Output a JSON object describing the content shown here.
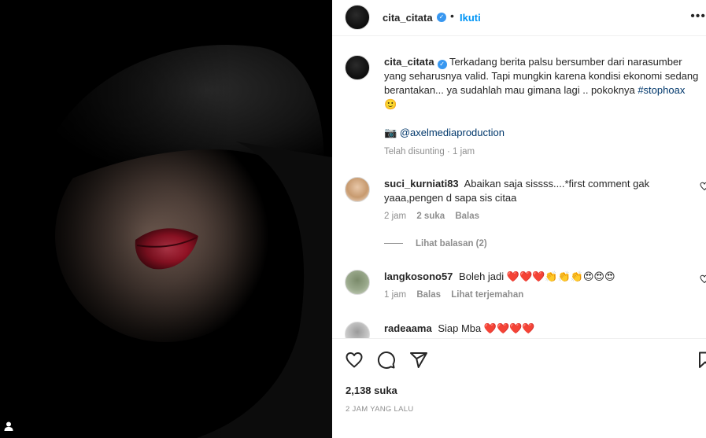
{
  "post": {
    "author": "cita_citata",
    "follow_label": "Ikuti",
    "separator": "•",
    "more_label": "•••"
  },
  "caption": {
    "author": "cita_citata",
    "text": "Terkadang berita palsu bersumber dari narasumber yang seharusnya valid. Tapi mungkin karena kondisi ekonomi sedang berantakan... ya sudahlah mau gimana lagi .. pokoknya ",
    "hashtag": "#stophoax",
    "emoji": "🙂",
    "credit_emoji": "📷",
    "credit_mention": "@axelmediaproduction",
    "edited": "Telah disunting",
    "edited_sep": "·",
    "time": "1 jam"
  },
  "comments": [
    {
      "user": "suci_kurniati83",
      "text": "Abaikan saja sissss....*first comment gak yaaa,pengen d sapa sis citaa",
      "time": "2 jam",
      "likes": "2 suka",
      "reply": "Balas",
      "view_replies": "Lihat balasan (2)"
    },
    {
      "user": "langkosono57",
      "text": "Boleh jadi ❤️❤️❤️👏👏👏😍😍😍",
      "time": "1 jam",
      "reply": "Balas",
      "translate": "Lihat terjemahan"
    },
    {
      "user": "radeaama",
      "text": "Siap Mba ❤️❤️❤️❤️"
    }
  ],
  "engagement": {
    "likes": "2,138 suka",
    "posted": "2 JAM YANG LALU"
  },
  "icons": [
    "heart-icon",
    "comment-icon",
    "share-icon",
    "bookmark-icon",
    "more-icon",
    "verified-icon",
    "user-tag-icon"
  ],
  "colors": {
    "link": "#0095f6",
    "verified": "#3897f0",
    "muted": "#8e8e8e",
    "text": "#262626"
  }
}
